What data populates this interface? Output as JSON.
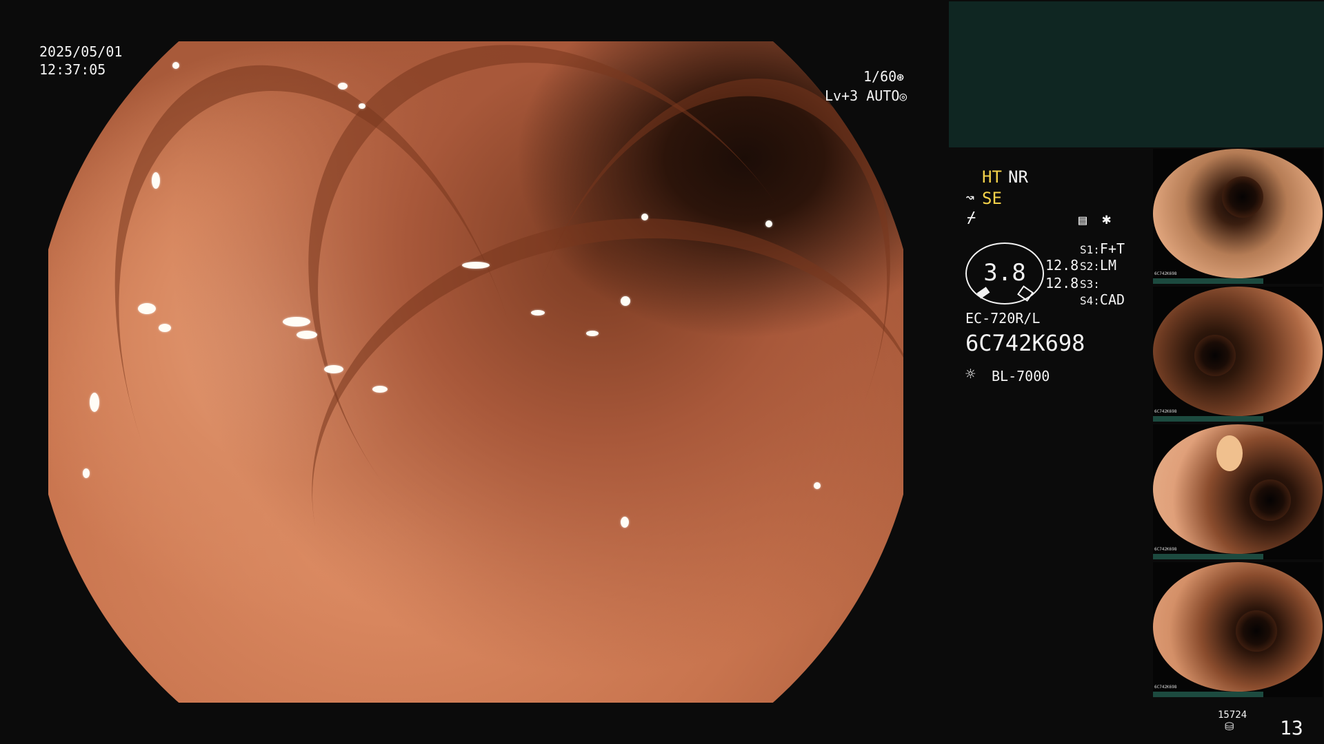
{
  "datetime": {
    "date": "2025/05/01",
    "time": "12:37:05"
  },
  "exposure": {
    "shutter": "1/60",
    "level": "Lv+3",
    "mode": "AUTO"
  },
  "enhancement": {
    "ht": "HT",
    "nr": "NR",
    "se": "SE"
  },
  "gauge": {
    "value": "3.8",
    "upper": "12.8",
    "lower": "12.8"
  },
  "switches": {
    "s1_label": "S1:",
    "s1_value": "F+T",
    "s2_label": "S2:",
    "s2_value": "LM",
    "s3_label": "S3:",
    "s3_value": "",
    "s4_label": "S4:",
    "s4_value": "CAD"
  },
  "scope": {
    "model": "EC-720R/L",
    "serial": "6C742K698",
    "light_source": "BL-7000"
  },
  "storage": {
    "remaining": "15724",
    "count": "13"
  },
  "thumbnails": [
    {
      "label": "6C742K698"
    },
    {
      "label": "6C742K698"
    },
    {
      "label": "6C742K698"
    },
    {
      "label": "6C742K698"
    }
  ],
  "colors": {
    "overlay_text": "#f4f4f4",
    "highlight_yellow": "#f4d24a",
    "panel_teal": "#0f2622"
  },
  "icons": [
    "shutter-icon",
    "auto-iris-icon",
    "structure-enhance-icon",
    "color-enhance-icon",
    "memory-icon",
    "asterisk-icon",
    "light-source-icon",
    "storage-icon"
  ]
}
